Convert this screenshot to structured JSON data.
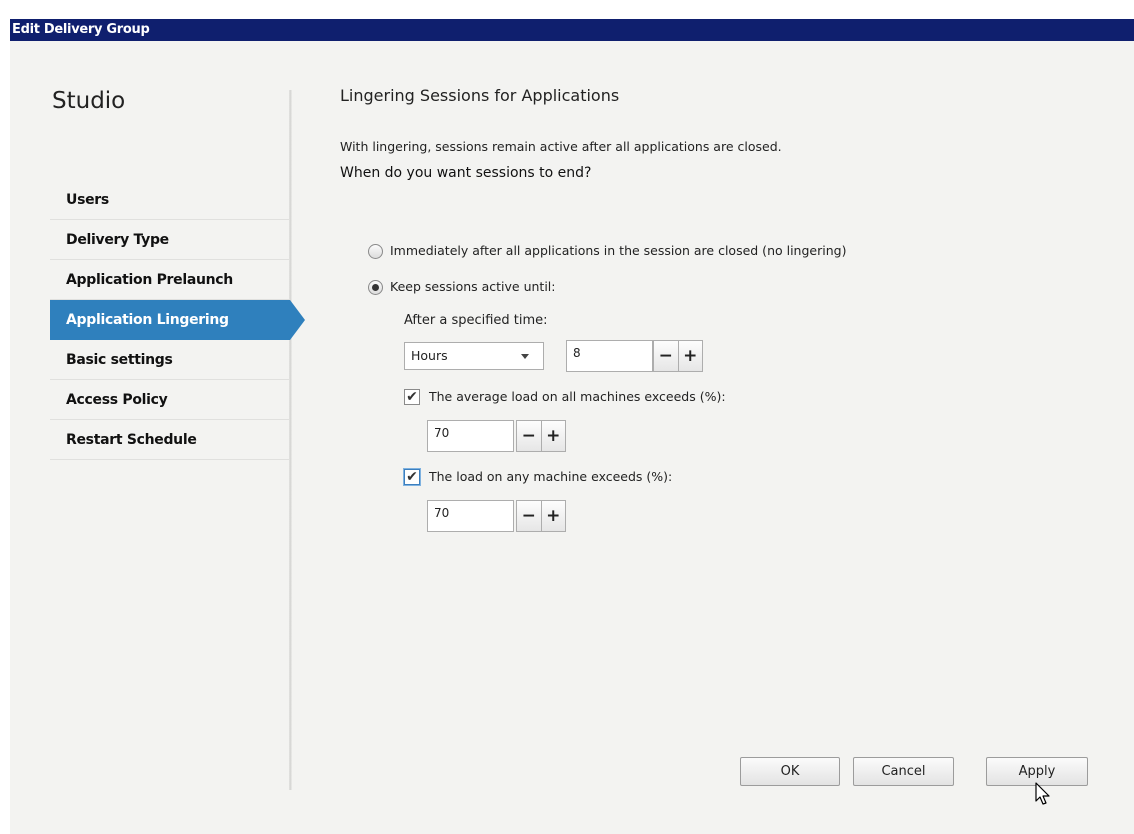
{
  "window": {
    "title": "Edit Delivery Group"
  },
  "sidebar": {
    "title": "Studio",
    "items": [
      {
        "label": "Users"
      },
      {
        "label": "Delivery Type"
      },
      {
        "label": "Application Prelaunch"
      },
      {
        "label": "Application Lingering",
        "active": true
      },
      {
        "label": "Basic settings"
      },
      {
        "label": "Access Policy"
      },
      {
        "label": "Restart Schedule"
      }
    ]
  },
  "main": {
    "heading": "Lingering Sessions for Applications",
    "intro": "With lingering, sessions remain active after all applications are closed.",
    "question": "When do you want sessions to end?",
    "options": [
      {
        "label": "Immediately after all applications in the session are closed (no lingering)",
        "selected": false
      },
      {
        "label": "Keep sessions active until:",
        "selected": true
      }
    ],
    "after_time": {
      "label": "After a specified time:",
      "unit": "Hours",
      "value": "8"
    },
    "avg_load": {
      "label": "The average load on all machines exceeds (%):",
      "checked": true,
      "value": "70"
    },
    "any_load": {
      "label": "The load on any machine exceeds (%):",
      "checked": true,
      "value": "70"
    },
    "stepper": {
      "minus": "−",
      "plus": "+"
    }
  },
  "footer": {
    "ok": "OK",
    "cancel": "Cancel",
    "apply": "Apply"
  },
  "icons": {
    "check": "✔",
    "cursor": "pointer-cursor-icon"
  }
}
